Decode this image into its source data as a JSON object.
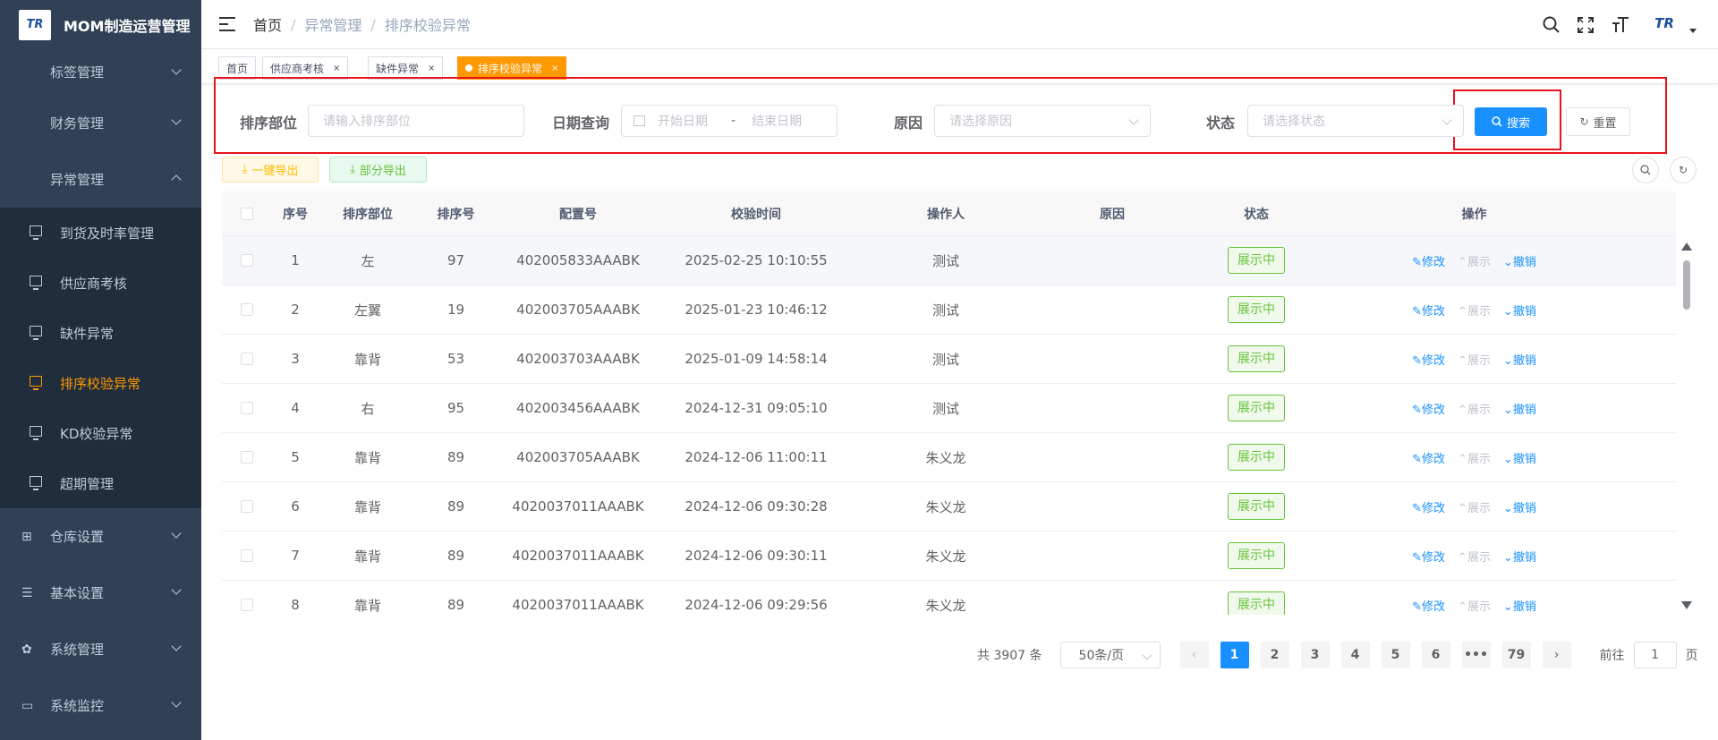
{
  "app": {
    "title": "MOM制造运营管理",
    "logo_text": "TR"
  },
  "sidebar": {
    "top_items": [
      {
        "label": "标签管理"
      },
      {
        "label": "财务管理"
      },
      {
        "label": "异常管理"
      }
    ],
    "sub_items": [
      {
        "label": "到货及时率管理"
      },
      {
        "label": "供应商考核"
      },
      {
        "label": "缺件异常"
      },
      {
        "label": "排序校验异常"
      },
      {
        "label": "KD校验异常"
      },
      {
        "label": "超期管理"
      }
    ],
    "bottom_items": [
      {
        "label": "仓库设置",
        "icon": "grid-icon"
      },
      {
        "label": "基本设置",
        "icon": "sliders-icon"
      },
      {
        "label": "系统管理",
        "icon": "gear-icon"
      },
      {
        "label": "系统监控",
        "icon": "monitor-icon"
      }
    ],
    "active_color": "#ff9900"
  },
  "breadcrumb": [
    "首页",
    "异常管理",
    "排序校验异常"
  ],
  "nav": {
    "avatar_text": "TR"
  },
  "tags": [
    {
      "label": "首页"
    },
    {
      "label": "供应商考核"
    },
    {
      "label": "缺件异常"
    },
    {
      "label": "排序校验异常"
    }
  ],
  "search": {
    "dept_label": "排序部位",
    "dept_placeholder": "请输入排序部位",
    "date_label": "日期查询",
    "date_start_placeholder": "开始日期",
    "date_sep": "-",
    "date_end_placeholder": "结束日期",
    "reason_label": "原因",
    "reason_placeholder": "请选择原因",
    "status_label": "状态",
    "status_placeholder": "请选择状态",
    "search_btn": "搜索",
    "reset_btn": "重置"
  },
  "toolbar": {
    "export_all": "一键导出",
    "export_part": "部分导出"
  },
  "table": {
    "headers": [
      "序号",
      "排序部位",
      "排序号",
      "配置号",
      "校验时间",
      "操作人",
      "原因",
      "状态",
      "操作"
    ],
    "rows": [
      {
        "no": "1",
        "dept": "左",
        "seq": "97",
        "config": "402005833AAABK",
        "time": "2025-02-25 10:10:55",
        "operator": "测试",
        "reason": "",
        "status": "展示中"
      },
      {
        "no": "2",
        "dept": "左翼",
        "seq": "19",
        "config": "402003705AAABK",
        "time": "2025-01-23 10:46:12",
        "operator": "测试",
        "reason": "",
        "status": "展示中"
      },
      {
        "no": "3",
        "dept": "靠背",
        "seq": "53",
        "config": "402003703AAABK",
        "time": "2025-01-09 14:58:14",
        "operator": "测试",
        "reason": "",
        "status": "展示中"
      },
      {
        "no": "4",
        "dept": "右",
        "seq": "95",
        "config": "402003456AAABK",
        "time": "2024-12-31 09:05:10",
        "operator": "测试",
        "reason": "",
        "status": "展示中"
      },
      {
        "no": "5",
        "dept": "靠背",
        "seq": "89",
        "config": "402003705AAABK",
        "time": "2024-12-06 11:00:11",
        "operator": "朱义龙",
        "reason": "",
        "status": "展示中"
      },
      {
        "no": "6",
        "dept": "靠背",
        "seq": "89",
        "config": "4020037011AAABK",
        "time": "2024-12-06 09:30:28",
        "operator": "朱义龙",
        "reason": "",
        "status": "展示中"
      },
      {
        "no": "7",
        "dept": "靠背",
        "seq": "89",
        "config": "4020037011AAABK",
        "time": "2024-12-06 09:30:11",
        "operator": "朱义龙",
        "reason": "",
        "status": "展示中"
      },
      {
        "no": "8",
        "dept": "靠背",
        "seq": "89",
        "config": "4020037011AAABK",
        "time": "2024-12-06 09:29:56",
        "operator": "朱义龙",
        "reason": "",
        "status": "展示中"
      }
    ],
    "actions": {
      "edit": "修改",
      "show": "展示",
      "cancel": "撤销"
    }
  },
  "pagination": {
    "total_text": "共 3907 条",
    "page_size": "50条/页",
    "pages": [
      "1",
      "2",
      "3",
      "4",
      "5",
      "6",
      "•••",
      "79"
    ],
    "current": "1",
    "goto_label": "前往",
    "goto_value": "1",
    "goto_suffix": "页"
  }
}
